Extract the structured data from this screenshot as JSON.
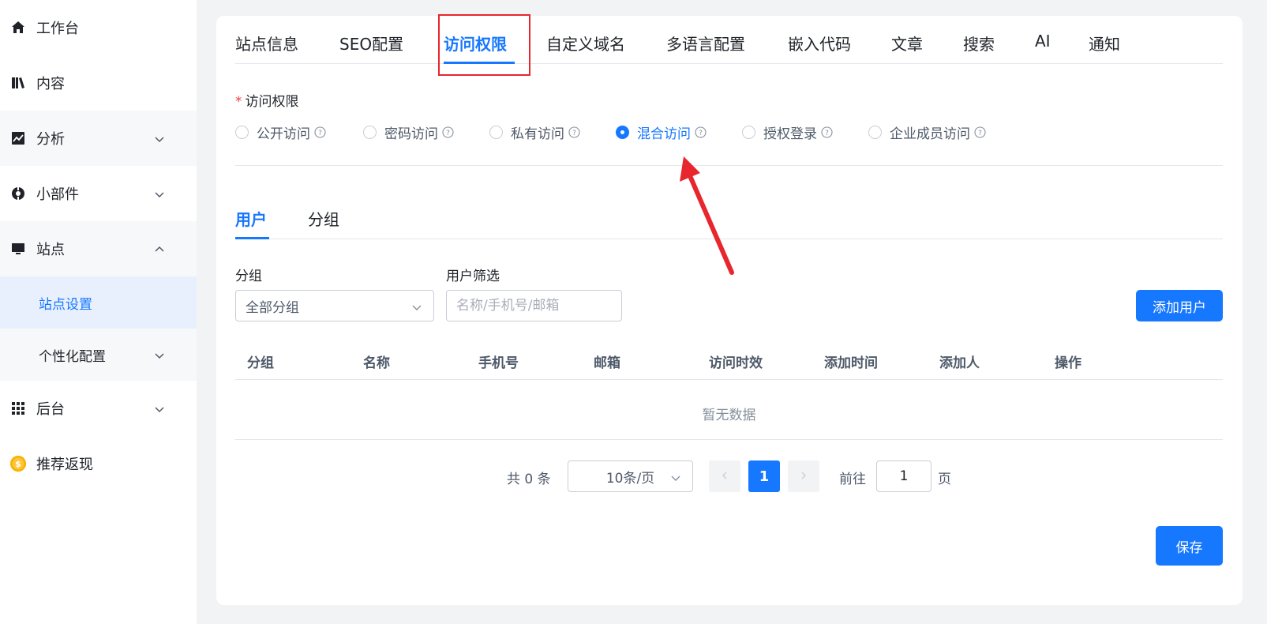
{
  "sidebar": {
    "items": [
      {
        "label": "工作台",
        "icon": "home-icon"
      },
      {
        "label": "内容",
        "icon": "books-icon"
      },
      {
        "label": "分析",
        "icon": "chart-icon"
      },
      {
        "label": "小部件",
        "icon": "widget-icon"
      },
      {
        "label": "站点",
        "icon": "monitor-icon"
      },
      {
        "label": "后台",
        "icon": "grid-icon"
      },
      {
        "label": "推荐返现",
        "icon": "coin-icon"
      }
    ],
    "sub_items": [
      {
        "label": "站点设置"
      },
      {
        "label": "个性化配置"
      }
    ]
  },
  "top_tabs": [
    {
      "label": "站点信息"
    },
    {
      "label": "SEO配置"
    },
    {
      "label": "访问权限"
    },
    {
      "label": "自定义域名"
    },
    {
      "label": "多语言配置"
    },
    {
      "label": "嵌入代码"
    },
    {
      "label": "文章"
    },
    {
      "label": "搜索"
    },
    {
      "label": "AI"
    },
    {
      "label": "通知"
    }
  ],
  "access": {
    "label": "访问权限",
    "required_mark": "*",
    "options": [
      {
        "label": "公开访问",
        "checked": false
      },
      {
        "label": "密码访问",
        "checked": false
      },
      {
        "label": "私有访问",
        "checked": false
      },
      {
        "label": "混合访问",
        "checked": true
      },
      {
        "label": "授权登录",
        "checked": false
      },
      {
        "label": "企业成员访问",
        "checked": false
      }
    ]
  },
  "sub_tabs": [
    {
      "label": "用户"
    },
    {
      "label": "分组"
    }
  ],
  "filters": {
    "group_label": "分组",
    "group_value": "全部分组",
    "user_label": "用户筛选",
    "user_placeholder": "名称/手机号/邮箱",
    "add_button": "添加用户"
  },
  "table": {
    "columns": [
      "分组",
      "名称",
      "手机号",
      "邮箱",
      "访问时效",
      "添加时间",
      "添加人",
      "操作"
    ],
    "empty_text": "暂无数据"
  },
  "pagination": {
    "total": "共 0 条",
    "page_size": "10条/页",
    "current_page": "1",
    "goto_label": "前往",
    "goto_value": "1",
    "page_suffix": "页"
  },
  "save_button": "保存",
  "colors": {
    "accent": "#1677ff",
    "annotation_red": "#e8262e"
  }
}
